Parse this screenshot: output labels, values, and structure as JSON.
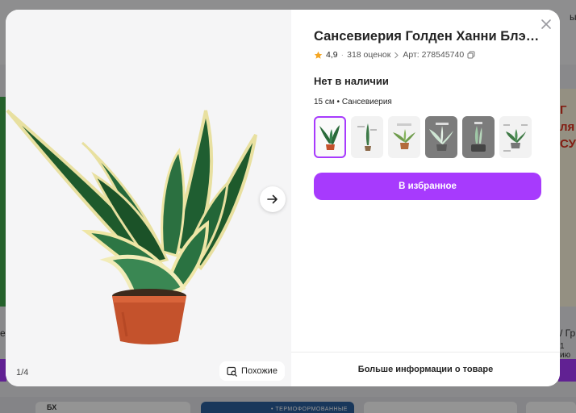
{
  "background": {
    "fragment_top_right": "ы",
    "fragment_right_title": "Г\nля\nСУ",
    "fragment_left_mid": "е",
    "fragment_right_mid": "/ Гр",
    "fragment_right_date": "1 ию",
    "fragment_bottom_left": "БХ",
    "fragment_bottom_banner": "• ТЕРМОФОРМОВАННЫЕ"
  },
  "product": {
    "title": "Сансевиерия Голден Ханни Блэк ...",
    "rating": "4,9",
    "reviews": "318 оценок",
    "article": "Арт: 278545740",
    "availability": "Нет в наличии",
    "variant": "15 см • Сансевиерия",
    "favorite_label": "В избранное",
    "more_info_label": "Больше информации о товаре"
  },
  "gallery": {
    "counter": "1/4",
    "similar_label": "Похожие"
  },
  "icons": {
    "close": "close-icon",
    "star": "star-icon",
    "chevron": "chevron-right-icon",
    "copy": "copy-icon",
    "next": "arrow-right-icon",
    "similar": "image-search-icon"
  },
  "colors": {
    "accent": "#a73afd",
    "star": "#f5a623",
    "leaf_dark": "#1e5a2c",
    "leaf_edge": "#e8e0a0",
    "pot": "#c4522c"
  },
  "thumbnails": [
    {
      "name": "thumb-1",
      "selected": true
    },
    {
      "name": "thumb-2",
      "selected": false
    },
    {
      "name": "thumb-3",
      "selected": false
    },
    {
      "name": "thumb-4",
      "selected": false
    },
    {
      "name": "thumb-5",
      "selected": false
    },
    {
      "name": "thumb-6",
      "selected": false
    }
  ]
}
